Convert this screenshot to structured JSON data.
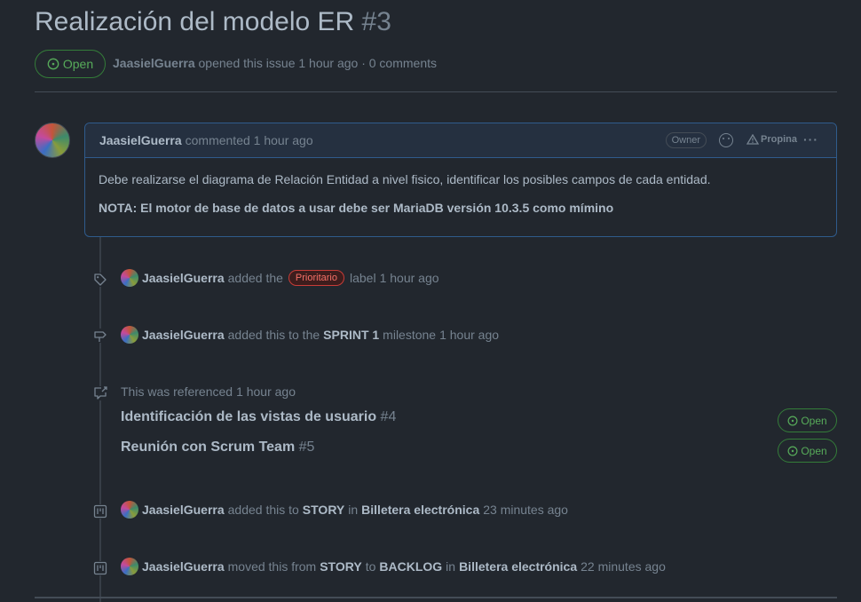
{
  "issue": {
    "title": "Realización del modelo ER",
    "number": "#3",
    "state": "Open",
    "author": "JaasielGuerra",
    "meta_text": "opened this issue 1 hour ago · 0 comments"
  },
  "comment": {
    "author": "JaasielGuerra",
    "time": "commented 1 hour ago",
    "owner_badge": "Owner",
    "propina": "Propina",
    "more": "···",
    "body": "Debe realizarse el diagrama de Relación Entidad a nivel fisico, identificar los posibles campos de cada entidad.",
    "note": "NOTA: El motor de base de datos a usar debe ser MariaDB versión 10.3.5 como mímino"
  },
  "timeline": [
    {
      "user": "JaasielGuerra",
      "pre": "added the",
      "label": "Prioritario",
      "post": "label",
      "time": "1 hour ago"
    },
    {
      "user": "JaasielGuerra",
      "pre": "added this to the",
      "milestone": "SPRINT 1",
      "post": "milestone",
      "time": "1 hour ago"
    },
    {
      "text": "This was referenced",
      "time": "1 hour ago",
      "refs": [
        {
          "title": "Identificación de las vistas de usuario",
          "number": "#4",
          "state": "Open"
        },
        {
          "title": "Reunión con Scrum Team",
          "number": "#5",
          "state": "Open"
        }
      ]
    },
    {
      "user": "JaasielGuerra",
      "pre": "added this to",
      "column": "STORY",
      "mid": "in",
      "project": "Billetera electrónica",
      "time": "23 minutes ago"
    },
    {
      "user": "JaasielGuerra",
      "pre": "moved this from",
      "from": "STORY",
      "to_word": "to",
      "to": "BACKLOG",
      "mid": "in",
      "project": "Billetera electrónica",
      "time": "22 minutes ago"
    }
  ],
  "colors": {
    "background": "#22272e",
    "open_green": "#57ab5a",
    "label_red": "#f47067",
    "comment_border": "#2f5b8c"
  }
}
